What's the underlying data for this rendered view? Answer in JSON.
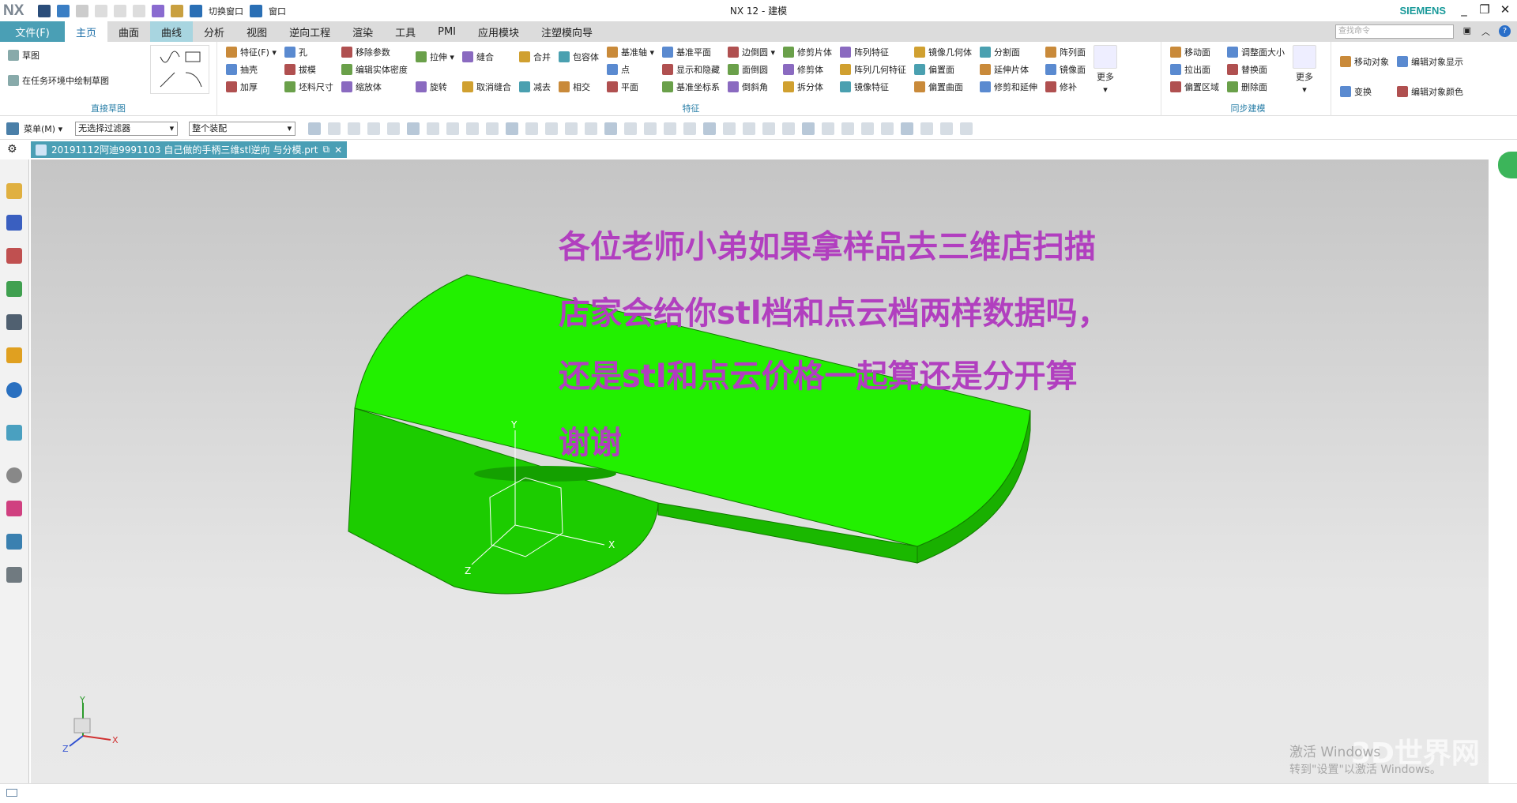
{
  "titlebar": {
    "logo": "NX",
    "title": "NX 12 - 建模",
    "brand": "SIEMENS",
    "switch_window": "切换窗口",
    "window": "窗口"
  },
  "tabs": [
    "文件(F)",
    "主页",
    "曲面",
    "曲线",
    "分析",
    "视图",
    "逆向工程",
    "渲染",
    "工具",
    "PMI",
    "应用模块",
    "注塑模向导"
  ],
  "search_placeholder": "查找命令",
  "ribbon": {
    "sketch": {
      "label": "直接草图",
      "items": [
        "草图",
        "在任务环境中绘制草图"
      ]
    },
    "feature": {
      "label": "特征",
      "cols": [
        [
          "特征(F) ▾",
          "抽壳",
          "加厚"
        ],
        [
          "孔",
          "拔模",
          "坯料尺寸"
        ],
        [
          "移除参数",
          "编辑实体密度",
          "缩放体"
        ],
        [
          "拉伸 ▾",
          "旋转"
        ],
        [
          "缝合",
          "取消缝合"
        ],
        [
          "合并",
          "减去"
        ],
        [
          "包容体",
          "相交"
        ],
        [
          "基准轴 ▾",
          "点",
          "平面"
        ],
        [
          "基准平面",
          "显示和隐藏",
          "基准坐标系"
        ],
        [
          "边倒圆 ▾",
          "面倒圆",
          "倒斜角"
        ],
        [
          "修剪片体",
          "修剪体",
          "拆分体"
        ],
        [
          "阵列特征",
          "阵列几何特征",
          "镜像特征"
        ],
        [
          "镜像几何体",
          "偏置面",
          "偏置曲面"
        ],
        [
          "分割面",
          "延伸片体",
          "修剪和延伸"
        ],
        [
          "阵列面",
          "镜像面",
          "修补"
        ]
      ],
      "more": "更多"
    },
    "sync": {
      "label": "同步建模",
      "cols": [
        [
          "移动面",
          "拉出面",
          "偏置区域"
        ],
        [
          "调整面大小",
          "替换面",
          "删除面"
        ]
      ],
      "more": "更多"
    },
    "edit": {
      "cols": [
        [
          "移动对象",
          "变换"
        ],
        [
          "编辑对象显示",
          "编辑对象颜色"
        ]
      ]
    }
  },
  "toolbar2": {
    "menu": "菜单(M) ▾",
    "filter": "无选择过滤器",
    "scope": "整个装配"
  },
  "document_tab": "20191112阿迪9991103   自己做的手柄三维stl逆向 与分模.prt",
  "viewport": {
    "message": [
      "各位老师小弟如果拿样品去三维店扫描",
      "店家会给你stl档和点云档两样数据吗，",
      "还是stl和点云价格一起算还是分开算",
      "谢谢"
    ],
    "axes": {
      "x": "X",
      "y": "Y",
      "z": "Z"
    }
  },
  "watermark": {
    "line1": "激活 Windows",
    "line2": "转到\"设置\"以激活 Windows。",
    "site": "3D世界网"
  },
  "colors": {
    "accent": "#4a9fb5",
    "part_top": "#22f000",
    "part_side": "#1ccc00",
    "message": "#b13fbf"
  }
}
